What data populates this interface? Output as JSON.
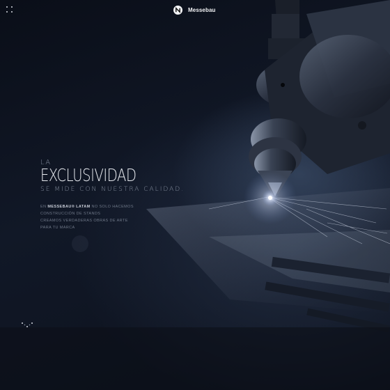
{
  "header": {
    "menu_icon": "grid-dots-icon",
    "brand_name": "Messebau",
    "brand_icon": "n-logo-icon"
  },
  "hero": {
    "kicker": "LA",
    "headline": "EXCLUSIVIDAD",
    "subline": "SE MIDE CON NUESTRA CALIDAD.",
    "body_prefix": "EN ",
    "body_brand": "MESSEBAU® LATAM",
    "body_rest_1": " NO SOLO HACEMOS",
    "body_line_2": "CONSTRUCCIÓN DE STANDS",
    "body_line_3": "CREAMOS VERDADERAS OBRAS DE ARTE",
    "body_line_4": "PARA TU MARCA"
  },
  "footer": {
    "scroll_icon": "chevron-dots-down-icon"
  },
  "colors": {
    "background": "#0b0f19",
    "text_primary": "#e8ebf0",
    "text_muted": "#6f7888"
  }
}
